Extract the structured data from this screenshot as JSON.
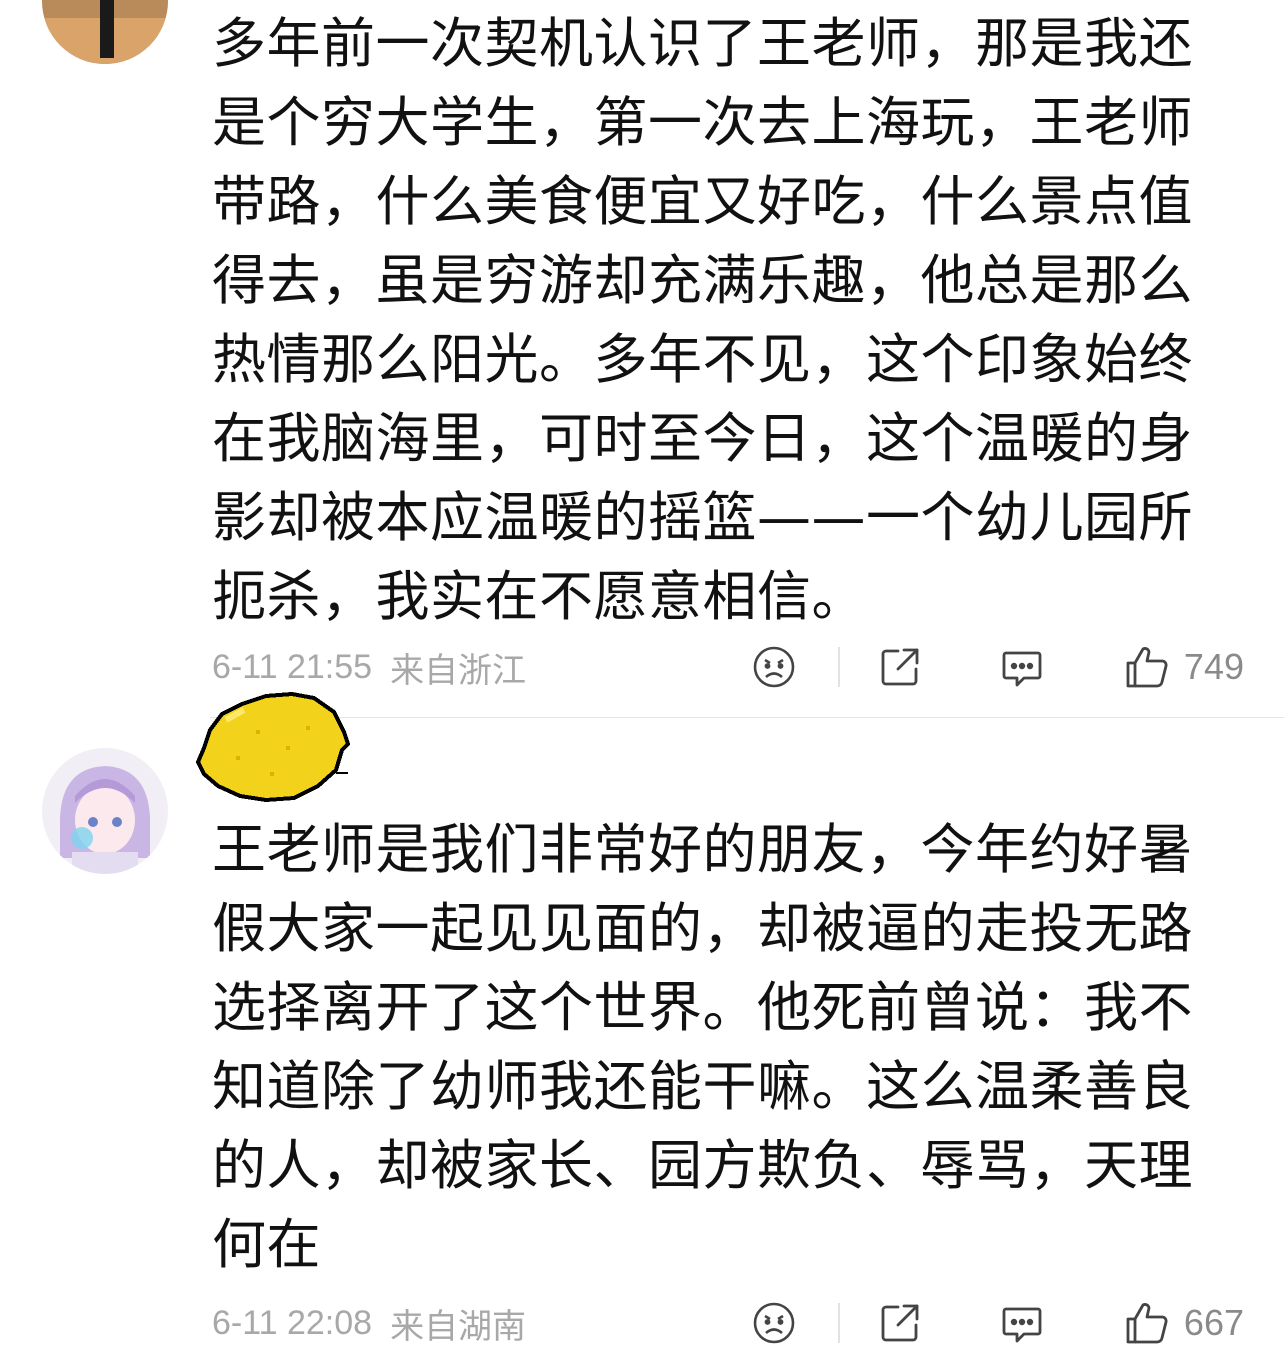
{
  "comments": [
    {
      "text": "多年前一次契机认识了王老师，那是我还是个穷大学生，第一次去上海玩，王老师带路，什么美食便宜又好吃，什么景点值得去，虽是穷游却充满乐趣，他总是那么热情那么阳光。多年不见，这个印象始终在我脑海里，可时至今日，这个温暖的身影却被本应温暖的摇篮——一个幼儿园所扼杀，我实在不愿意相信。",
      "time": "6-11 21:55",
      "location": "来自浙江",
      "likes": "749",
      "icons": [
        "sad-face-icon",
        "share-icon",
        "reply-icon",
        "thumbs-up-icon"
      ]
    },
    {
      "text": "王老师是我们非常好的朋友，今年约好暑假大家一起见见面的，却被逼的走投无路选择离开了这个世界。他死前曾说：我不知道除了幼师我还能干嘛。这么温柔善良的人，却被家长、园方欺负、辱骂，天理何在",
      "time": "6-11 22:08",
      "location": "来自湖南",
      "likes": "667",
      "badge": "lemon-badge",
      "icons": [
        "sad-face-icon",
        "share-icon",
        "reply-icon",
        "thumbs-up-icon"
      ]
    }
  ]
}
